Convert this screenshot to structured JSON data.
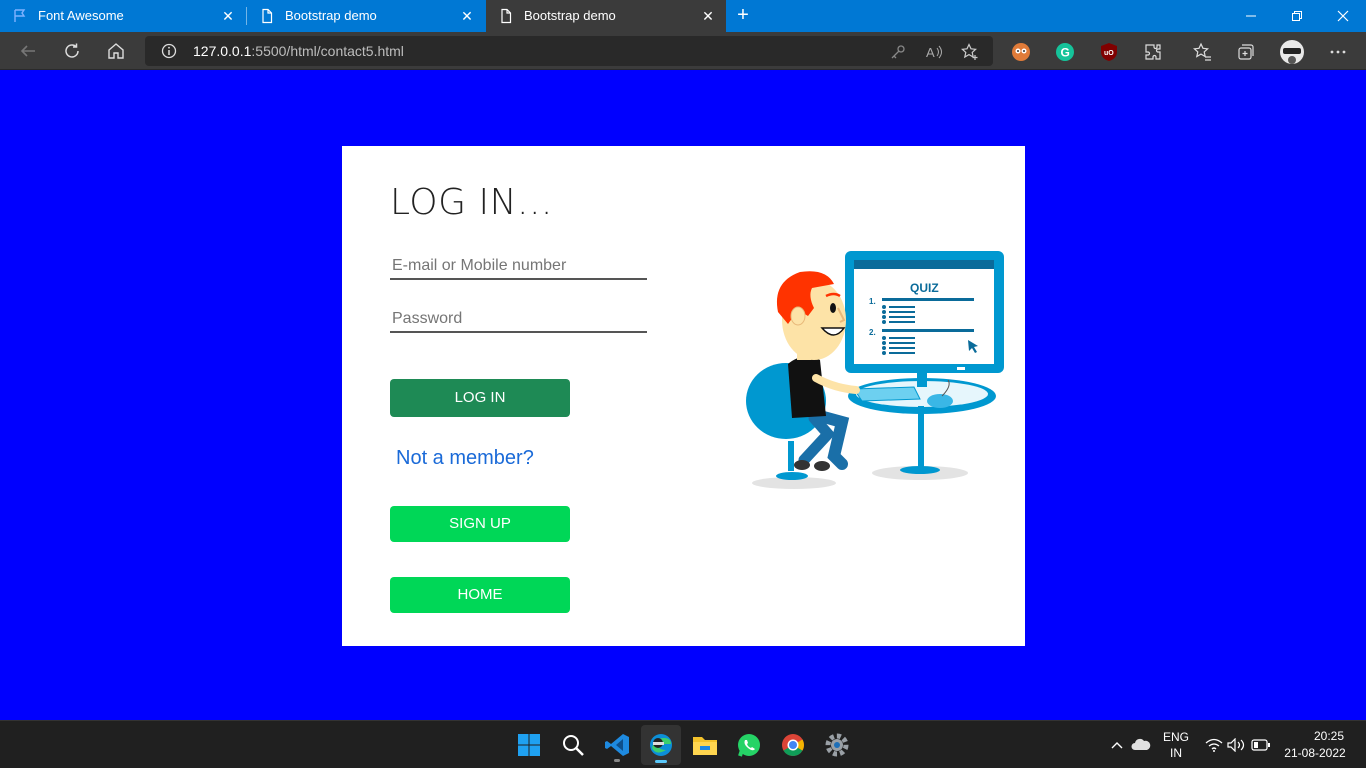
{
  "browser": {
    "tabs": [
      {
        "title": "Font Awesome",
        "icon": "flag-icon",
        "active": false
      },
      {
        "title": "Bootstrap demo",
        "icon": "page-icon",
        "active": false
      },
      {
        "title": "Bootstrap demo",
        "icon": "page-icon",
        "active": true
      }
    ],
    "address": {
      "host": "127.0.0.1",
      "rest": ":5500/html/contact5.html"
    }
  },
  "colors": {
    "page_background": "#0000ff",
    "login_button": "#1e8a55",
    "signup_button": "#00d757",
    "home_button": "#00d757",
    "link": "#1a6ad8",
    "browser_accent": "#0078d4"
  },
  "login": {
    "title": "LOG IN...",
    "email_placeholder": "E-mail or Mobile number",
    "email_value": "",
    "password_placeholder": "Password",
    "password_value": "",
    "login_button": "LOG IN",
    "not_member_link": "Not a member?",
    "signup_button": "SIGN UP",
    "home_button": "HOME"
  },
  "illustration": {
    "screen_title": "QUIZ",
    "item_1": "1.",
    "item_2": "2."
  },
  "taskbar": {
    "apps": [
      "windows-start",
      "search",
      "vscode",
      "edge",
      "file-explorer",
      "whatsapp",
      "chrome",
      "settings"
    ],
    "language_line1": "ENG",
    "language_line2": "IN",
    "time": "20:25",
    "date": "21-08-2022"
  }
}
